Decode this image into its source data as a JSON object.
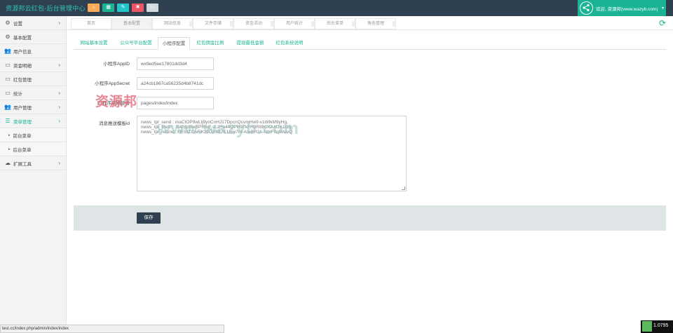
{
  "brand": "资源邦云红包-后台管理中心",
  "header_buttons": [
    {
      "icon": "home-icon",
      "glyph": "⌂",
      "color": "#f8ac59"
    },
    {
      "icon": "grid-icon",
      "glyph": "▦",
      "color": "#1ab394"
    },
    {
      "icon": "edit-icon",
      "glyph": "✎",
      "color": "#23c6c8"
    },
    {
      "icon": "delete-icon",
      "glyph": "✖",
      "color": "#ed5565"
    },
    {
      "icon": "screen-icon",
      "glyph": "▭",
      "color": "#d1dade"
    }
  ],
  "user": {
    "welcome": "欢迎, 资源邦(www.wazyb.com)",
    "caret": "▾"
  },
  "sidebar": {
    "items": [
      {
        "name": "settings",
        "icon": "⚙",
        "label": "设置",
        "arrow": "›"
      },
      {
        "name": "basic-config",
        "icon": "⚙",
        "label": "基本配置",
        "arrow": ""
      },
      {
        "name": "user-info",
        "icon": "👥",
        "label": "用户信息",
        "arrow": ""
      },
      {
        "name": "fund-detail",
        "icon": "▭",
        "label": "资金明细",
        "arrow": "›"
      },
      {
        "name": "redpacket-manage",
        "icon": "▭",
        "label": "红包管理",
        "arrow": ""
      },
      {
        "name": "stats",
        "icon": "▭",
        "label": "统计",
        "arrow": "›"
      },
      {
        "name": "user-manage",
        "icon": "👥",
        "label": "用户管理",
        "arrow": "›"
      },
      {
        "name": "menu-manage",
        "icon": "☰",
        "label": "菜单管理",
        "arrow": "›"
      }
    ],
    "subitems": [
      {
        "label": "前台菜单"
      },
      {
        "label": "后台菜单"
      }
    ],
    "extend": {
      "icon": "☁",
      "label": "扩展工具",
      "arrow": "›"
    }
  },
  "page_tabs": [
    "首页",
    "基本配置",
    "网站信息",
    "文件存储",
    "资金活动",
    "用户统计",
    "后台菜单",
    "角色管理"
  ],
  "inner_tabs": [
    "网站基本设置",
    "公众号平台配置",
    "小程序配置",
    "红包佣金比例",
    "提现最低金额",
    "红包系统说明"
  ],
  "active_inner_tab": 2,
  "form": {
    "appid_label": "小程序AppID",
    "appid_value": "wx9ed5ee17801dd3d4",
    "secret_label": "小程序AppSecret",
    "secret_value": "a24cb1867ca56235d4b8741dc",
    "path_label": "小程序网络链接",
    "path_value": "pages/index/index",
    "tpl_label": "消息推送模板id",
    "tpl_lines": [
      "news_tpl_send : maCtOP9wLlj9ynCnHJ17DpcnQcvmHw9-v1WlkM9yHg,",
      "news_tpl_finish : 9i4zgdNw5PR6g_sLzHv44QPH9TkFH3R8lKoOlAUA1Gg,",
      "news_tpl_refund: XlEWZCwRKz9Dzf687K1Ivw7r4-AIaBH2A-NbIF0qWwvQ"
    ],
    "save_label": "保存"
  },
  "watermark": {
    "line1": "资源邦",
    "line2": "www.wazyb.com"
  },
  "status_url": "test.cc/index.php/admin/index/index",
  "tray_text": "1.0795"
}
